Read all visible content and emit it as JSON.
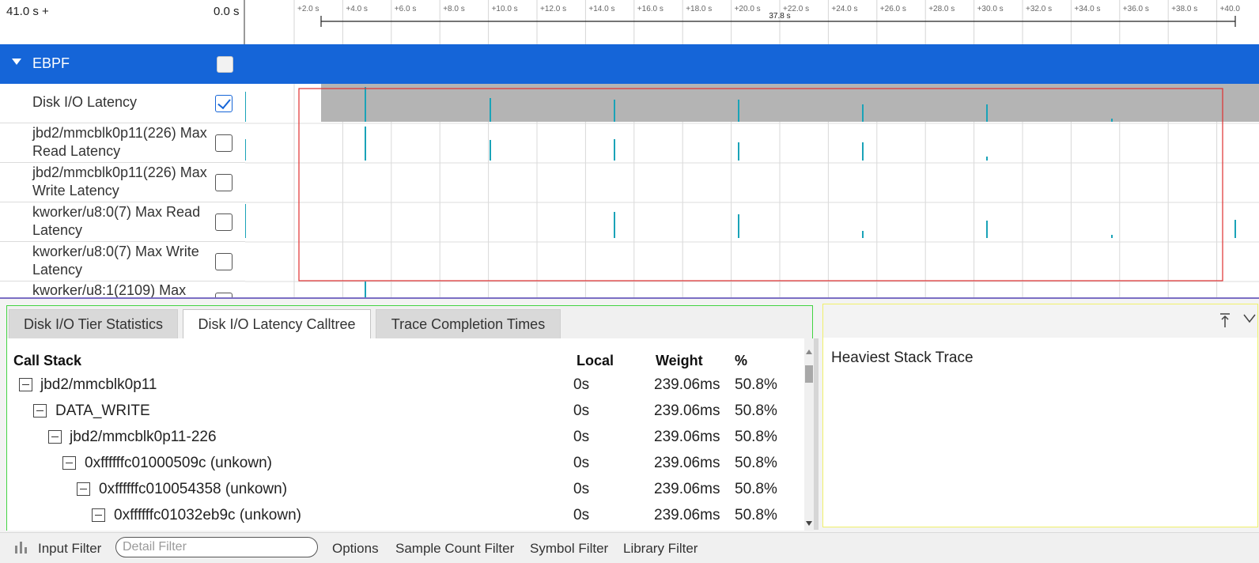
{
  "timeline": {
    "range_left": "41.0 s +",
    "range_offset": "0.0 s",
    "ticks": [
      "+2.0 s",
      "+4.0 s",
      "+6.0 s",
      "+8.0 s",
      "+10.0 s",
      "+12.0 s",
      "+14.0 s",
      "+16.0 s",
      "+18.0 s",
      "+20.0 s",
      "+22.0 s",
      "+24.0 s",
      "+26.0 s",
      "+28.0 s",
      "+30.0 s",
      "+32.0 s",
      "+34.0 s",
      "+36.0 s",
      "+38.0 s",
      "+40.0"
    ],
    "selection_label": "37.8 s"
  },
  "group": {
    "title": "EBPF",
    "checked": false
  },
  "tracks": [
    {
      "name": "Disk I/O Latency",
      "checked": true
    },
    {
      "name": "jbd2/mmcblk0p11(226) Max Read Latency",
      "checked": false
    },
    {
      "name": "jbd2/mmcblk0p11(226) Max Write Latency",
      "checked": false
    },
    {
      "name": "kworker/u8:0(7) Max Read Latency",
      "checked": false
    },
    {
      "name": "kworker/u8:0(7) Max Write Latency",
      "checked": false
    },
    {
      "name": "kworker/u8:1(2109) Max",
      "checked": false
    }
  ],
  "tabs": [
    {
      "label": "Disk I/O Tier Statistics",
      "active": false
    },
    {
      "label": "Disk I/O Latency Calltree",
      "active": true
    },
    {
      "label": "Trace Completion Times",
      "active": false
    }
  ],
  "calltree": {
    "columns": {
      "call_stack": "Call Stack",
      "local": "Local",
      "weight": "Weight",
      "percent": "%"
    },
    "rows": [
      {
        "name": "jbd2/mmcblk0p11",
        "local": "0s",
        "weight": "239.06ms",
        "percent": "50.8%",
        "depth": 0
      },
      {
        "name": "DATA_WRITE",
        "local": "0s",
        "weight": "239.06ms",
        "percent": "50.8%",
        "depth": 1
      },
      {
        "name": "jbd2/mmcblk0p11-226",
        "local": "0s",
        "weight": "239.06ms",
        "percent": "50.8%",
        "depth": 2
      },
      {
        "name": "0xffffffc01000509c (unkown)",
        "local": "0s",
        "weight": "239.06ms",
        "percent": "50.8%",
        "depth": 3
      },
      {
        "name": "0xffffffc010054358 (unkown)",
        "local": "0s",
        "weight": "239.06ms",
        "percent": "50.8%",
        "depth": 4
      },
      {
        "name": "0xffffffc01032eb9c (unkown)",
        "local": "0s",
        "weight": "239.06ms",
        "percent": "50.8%",
        "depth": 5
      }
    ]
  },
  "heaviest": {
    "title": "Heaviest Stack Trace"
  },
  "filters": {
    "input_filter": "Input Filter",
    "detail_placeholder": "Detail Filter",
    "options": "Options",
    "sample_count": "Sample Count Filter",
    "symbol": "Symbol Filter",
    "library": "Library Filter"
  },
  "colors": {
    "group_bar": "#1565d8",
    "spike": "#1aa3b8",
    "selection_box": "#e03030",
    "calltree_border": "#43d443",
    "heaviest_border": "#f0f06a"
  }
}
